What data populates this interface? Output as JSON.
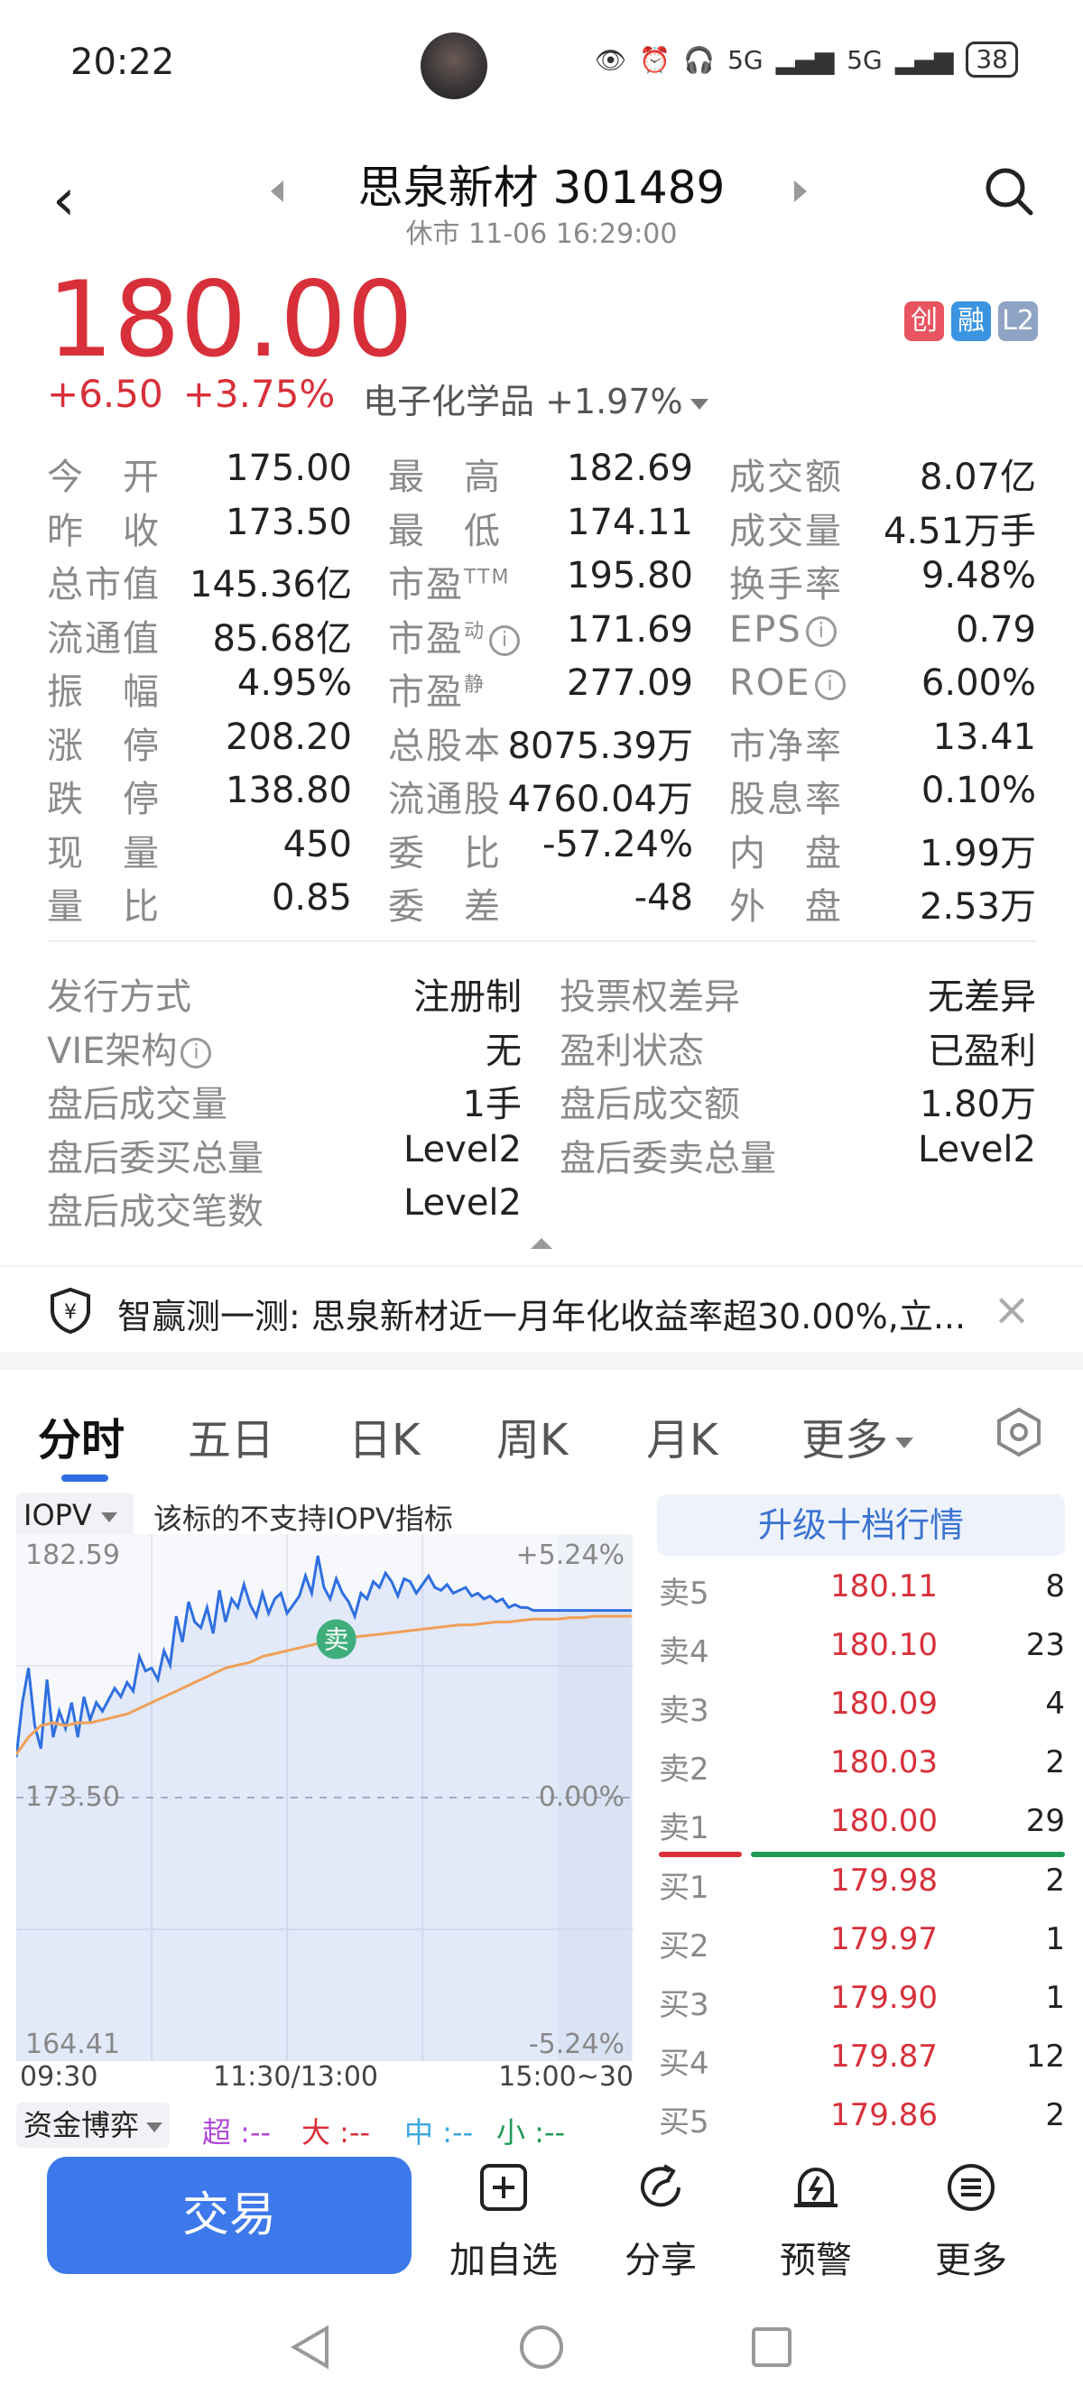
{
  "status_bar": {
    "time": "20:22",
    "battery": "38",
    "network1": "5G",
    "network2": "5G"
  },
  "header": {
    "title": "思泉新材 301489",
    "subtitle": "休市 11-06 16:29:00"
  },
  "quote": {
    "price": "180.00",
    "change": "+6.50",
    "change_pct": "+3.75%",
    "sector": "电子化学品 +1.97%",
    "badges": [
      {
        "text": "创",
        "color": "#e8545f"
      },
      {
        "text": "融",
        "color": "#3a94e0"
      },
      {
        "text": "L2",
        "color": "#8fa4c4"
      }
    ]
  },
  "stats": [
    [
      {
        "label": "今　开",
        "value": "175.00",
        "color": "red"
      },
      {
        "label": "最　高",
        "value": "182.69",
        "color": "red"
      },
      {
        "label": "成交额",
        "value": "8.07亿",
        "color": ""
      }
    ],
    [
      {
        "label": "昨　收",
        "value": "173.50",
        "color": ""
      },
      {
        "label": "最　低",
        "value": "174.11",
        "color": "red"
      },
      {
        "label": "成交量",
        "value": "4.51万手",
        "color": ""
      }
    ],
    [
      {
        "label": "总市值",
        "value": "145.36亿",
        "color": ""
      },
      {
        "label": "市盈",
        "sup": "TTM",
        "value": "195.80",
        "color": ""
      },
      {
        "label": "换手率",
        "value": "9.48%",
        "color": ""
      }
    ],
    [
      {
        "label": "流通值",
        "value": "85.68亿",
        "color": ""
      },
      {
        "label": "市盈",
        "sup": "动",
        "info": true,
        "value": "171.69",
        "color": ""
      },
      {
        "label": "EPS",
        "info": true,
        "value": "0.79",
        "color": ""
      }
    ],
    [
      {
        "label": "振　幅",
        "value": "4.95%",
        "color": ""
      },
      {
        "label": "市盈",
        "sup": "静",
        "value": "277.09",
        "color": ""
      },
      {
        "label": "ROE",
        "info": true,
        "value": "6.00%",
        "color": ""
      }
    ],
    [
      {
        "label": "涨　停",
        "value": "208.20",
        "color": "red"
      },
      {
        "label": "总股本",
        "value": "8075.39万",
        "color": ""
      },
      {
        "label": "市净率",
        "value": "13.41",
        "color": ""
      }
    ],
    [
      {
        "label": "跌　停",
        "value": "138.80",
        "color": "green"
      },
      {
        "label": "流通股",
        "value": "4760.04万",
        "color": ""
      },
      {
        "label": "股息率",
        "value": "0.10%",
        "color": ""
      }
    ],
    [
      {
        "label": "现　量",
        "value": "450",
        "color": ""
      },
      {
        "label": "委　比",
        "value": "-57.24%",
        "color": "green"
      },
      {
        "label": "内　盘",
        "value": "1.99万",
        "color": "green"
      }
    ],
    [
      {
        "label": "量　比",
        "value": "0.85",
        "color": ""
      },
      {
        "label": "委　差",
        "value": "-48",
        "color": "green"
      },
      {
        "label": "外　盘",
        "value": "2.53万",
        "color": "red"
      }
    ]
  ],
  "extra": [
    [
      {
        "label": "发行方式",
        "value": "注册制",
        "color": ""
      },
      {
        "label": "投票权差异",
        "value": "无差异",
        "color": ""
      }
    ],
    [
      {
        "label": "VIE架构",
        "info": true,
        "value": "无",
        "color": ""
      },
      {
        "label": "盈利状态",
        "value": "已盈利",
        "color": ""
      }
    ],
    [
      {
        "label": "盘后成交量",
        "value": "1手",
        "color": ""
      },
      {
        "label": "盘后成交额",
        "value": "1.80万",
        "color": ""
      }
    ],
    [
      {
        "label": "盘后委买总量",
        "value": "Level2",
        "color": "blue"
      },
      {
        "label": "盘后委卖总量",
        "value": "Level2",
        "color": "blue"
      }
    ],
    [
      {
        "label": "盘后成交笔数",
        "value": "Level2",
        "color": "blue"
      }
    ]
  ],
  "banner": {
    "text": "智赢测一测: 思泉新材近一月年化收益率超30.00%,立..."
  },
  "tabs": [
    "分时",
    "五日",
    "日K",
    "周K",
    "月K",
    "更多"
  ],
  "chart_panel": {
    "iopv_label": "IOPV",
    "iopv_note": "该标的不支持IOPV指标",
    "y_max": "182.59",
    "y_mid": "173.50",
    "y_min": "164.41",
    "pct_max": "+5.24%",
    "pct_mid": "0.00%",
    "pct_min": "-5.24%",
    "x_start": "09:30",
    "x_mid": "11:30/13:00",
    "x_end": "15:00~30",
    "sell_marker": "卖",
    "flow_select": "资金博弈",
    "flow_items": [
      {
        "text": "超 :--",
        "color": "#b04ad8"
      },
      {
        "text": "大 :--",
        "color": "#d8303a"
      },
      {
        "text": "中 :--",
        "color": "#3aa7e0"
      },
      {
        "text": "小 :--",
        "color": "#1f9a57"
      }
    ]
  },
  "chart_data": {
    "type": "line",
    "x_range": [
      0,
      100
    ],
    "ylim": [
      164.41,
      182.59
    ],
    "y_labels": [
      "182.59",
      "173.50",
      "164.41"
    ],
    "x_labels": [
      "09:30",
      "11:30/13:00",
      "15:00~30"
    ],
    "series": [
      {
        "color": "#2f6fe0",
        "x": [
          0,
          1,
          2,
          3,
          4,
          5,
          6,
          7,
          8,
          9,
          10,
          11,
          12,
          13,
          14,
          15,
          16,
          17,
          18,
          19,
          20,
          21,
          22,
          23,
          24,
          25,
          26,
          27,
          28,
          29,
          30,
          31,
          32,
          33,
          34,
          35,
          36,
          37,
          38,
          39,
          40,
          41,
          42,
          43,
          44,
          45,
          46,
          47,
          48,
          49,
          50,
          51,
          52,
          53,
          54,
          55,
          56,
          57,
          58,
          59,
          60,
          61,
          62,
          63,
          64,
          65,
          66,
          67,
          68,
          69,
          70,
          71,
          72,
          73,
          74,
          75,
          76,
          77,
          78,
          79,
          80,
          81,
          82,
          83,
          84,
          85,
          86,
          88,
          90,
          92,
          94,
          96,
          98,
          100
        ],
        "y": [
          174.9,
          176.8,
          178.0,
          176.0,
          175.2,
          177.6,
          175.6,
          176.5,
          175.9,
          176.8,
          175.6,
          177.0,
          176.2,
          176.8,
          176.5,
          176.9,
          177.3,
          177.0,
          177.5,
          177.2,
          178.4,
          177.9,
          178.0,
          177.6,
          178.6,
          178.1,
          179.8,
          178.9,
          180.3,
          179.6,
          179.4,
          180.1,
          179.2,
          180.7,
          179.6,
          180.4,
          180.1,
          180.9,
          180.2,
          179.8,
          180.6,
          179.9,
          180.4,
          180.6,
          179.9,
          180.2,
          180.5,
          181.2,
          180.6,
          181.9,
          180.8,
          180.4,
          181.1,
          180.6,
          180.3,
          179.8,
          180.6,
          180.4,
          181.0,
          180.8,
          181.3,
          181.0,
          180.5,
          181.1,
          181.0,
          180.6,
          180.9,
          181.2,
          180.8,
          180.7,
          180.9,
          180.6,
          180.7,
          180.8,
          180.5,
          180.6,
          180.4,
          180.5,
          180.3,
          180.4,
          180.1,
          180.2,
          180.1,
          180.1,
          180.0,
          180.0,
          180.0,
          180.0,
          180.0,
          180.0,
          180.0,
          180.0,
          180.0,
          180.0
        ]
      },
      {
        "color": "#f0a057",
        "x": [
          0,
          2,
          4,
          6,
          8,
          10,
          12,
          14,
          16,
          18,
          20,
          22,
          24,
          26,
          28,
          30,
          32,
          34,
          36,
          38,
          40,
          42,
          44,
          46,
          48,
          50,
          52,
          54,
          56,
          58,
          60,
          62,
          64,
          66,
          68,
          70,
          72,
          74,
          76,
          78,
          80,
          82,
          84,
          86,
          88,
          90,
          92,
          94,
          96,
          98,
          100
        ],
        "y": [
          175.0,
          175.6,
          176.0,
          176.1,
          176.0,
          176.1,
          176.1,
          176.2,
          176.3,
          176.4,
          176.6,
          176.8,
          177.0,
          177.2,
          177.4,
          177.6,
          177.8,
          178.0,
          178.1,
          178.2,
          178.4,
          178.5,
          178.6,
          178.7,
          178.8,
          178.9,
          179.0,
          179.05,
          179.1,
          179.15,
          179.2,
          179.25,
          179.3,
          179.35,
          179.4,
          179.45,
          179.5,
          179.5,
          179.55,
          179.6,
          179.6,
          179.65,
          179.7,
          179.7,
          179.7,
          179.75,
          179.75,
          179.8,
          179.8,
          179.8,
          179.8
        ]
      }
    ],
    "reference_line": 173.5,
    "grid": true
  },
  "order_book": {
    "upgrade_label": "升级十档行情",
    "asks": [
      {
        "label": "卖5",
        "price": "180.11",
        "volume": "8"
      },
      {
        "label": "卖4",
        "price": "180.10",
        "volume": "23"
      },
      {
        "label": "卖3",
        "price": "180.09",
        "volume": "4"
      },
      {
        "label": "卖2",
        "price": "180.03",
        "volume": "2"
      },
      {
        "label": "卖1",
        "price": "180.00",
        "volume": "29"
      }
    ],
    "bids": [
      {
        "label": "买1",
        "price": "179.98",
        "volume": "2"
      },
      {
        "label": "买2",
        "price": "179.97",
        "volume": "1"
      },
      {
        "label": "买3",
        "price": "179.90",
        "volume": "1"
      },
      {
        "label": "买4",
        "price": "179.87",
        "volume": "12"
      },
      {
        "label": "买5",
        "price": "179.86",
        "volume": "2"
      }
    ]
  },
  "actions": {
    "trade": "交易",
    "watchlist": "加自选",
    "share": "分享",
    "alert": "预警",
    "more": "更多"
  }
}
